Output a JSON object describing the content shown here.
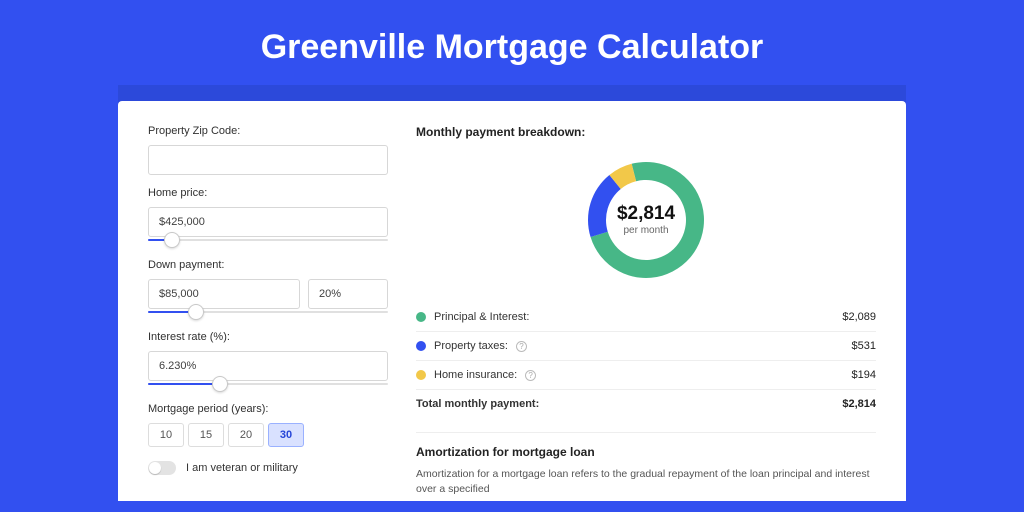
{
  "page": {
    "title": "Greenville Mortgage Calculator"
  },
  "form": {
    "zip": {
      "label": "Property Zip Code:",
      "value": ""
    },
    "home_price": {
      "label": "Home price:",
      "value": "$425,000",
      "slider_pct": 10
    },
    "down_payment": {
      "label": "Down payment:",
      "amount": "$85,000",
      "percent": "20%",
      "slider_pct": 20
    },
    "interest": {
      "label": "Interest rate (%):",
      "value": "6.230%",
      "slider_pct": 30
    },
    "period": {
      "label": "Mortgage period (years):",
      "options": [
        "10",
        "15",
        "20",
        "30"
      ],
      "active": 3
    },
    "veteran": {
      "label": "I am veteran or military"
    }
  },
  "breakdown": {
    "title": "Monthly payment breakdown:",
    "amount": "$2,814",
    "sub": "per month",
    "items": [
      {
        "label": "Principal & Interest:",
        "value": "$2,089",
        "color": "#47b787",
        "info": false
      },
      {
        "label": "Property taxes:",
        "value": "$531",
        "color": "#3250f0",
        "info": true
      },
      {
        "label": "Home insurance:",
        "value": "$194",
        "color": "#f2c849",
        "info": true
      }
    ],
    "total": {
      "label": "Total monthly payment:",
      "value": "$2,814"
    }
  },
  "amort": {
    "heading": "Amortization for mortgage loan",
    "text": "Amortization for a mortgage loan refers to the gradual repayment of the loan principal and interest over a specified"
  },
  "chart_data": {
    "type": "pie",
    "title": "Monthly payment breakdown",
    "categories": [
      "Principal & Interest",
      "Property taxes",
      "Home insurance"
    ],
    "values": [
      2089,
      531,
      194
    ],
    "colors": [
      "#47b787",
      "#3250f0",
      "#f2c849"
    ],
    "center_label": "$2,814",
    "center_sub": "per month"
  }
}
